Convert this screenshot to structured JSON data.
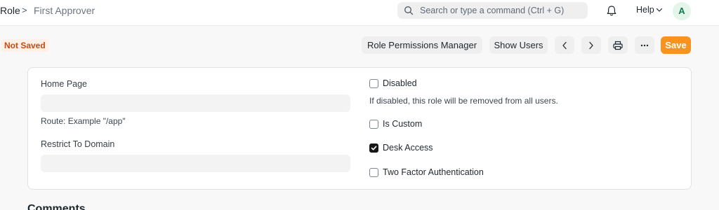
{
  "breadcrumb": {
    "root": "Role",
    "separator": ">",
    "current": "First Approver"
  },
  "search": {
    "placeholder": "Search or type a command (Ctrl + G)"
  },
  "navbar": {
    "help_label": "Help",
    "avatar_initial": "A"
  },
  "page": {
    "status_badge": "Not Saved",
    "buttons": {
      "role_permissions_manager": "Role Permissions Manager",
      "show_users": "Show Users",
      "save": "Save"
    }
  },
  "form": {
    "home_page": {
      "label": "Home Page",
      "value": "",
      "description": "Route: Example \"/app\""
    },
    "restrict_to_domain": {
      "label": "Restrict To Domain",
      "value": ""
    },
    "disabled": {
      "label": "Disabled",
      "checked": false,
      "description": "If disabled, this role will be removed from all users."
    },
    "is_custom": {
      "label": "Is Custom",
      "checked": false
    },
    "desk_access": {
      "label": "Desk Access",
      "checked": true
    },
    "two_factor_authentication": {
      "label": "Two Factor Authentication",
      "checked": false
    }
  },
  "comments": {
    "heading": "Comments"
  },
  "colors": {
    "accent": "#f7931e",
    "badge_text": "#cb4a10",
    "badge_bg": "#fff1e7",
    "avatar_bg": "#e4f5e9",
    "avatar_text": "#16794c"
  },
  "icons": [
    "search-icon",
    "bell-icon",
    "chevron-down-icon",
    "chevron-left-icon",
    "chevron-right-icon",
    "printer-icon",
    "more-icon",
    "check-icon"
  ]
}
